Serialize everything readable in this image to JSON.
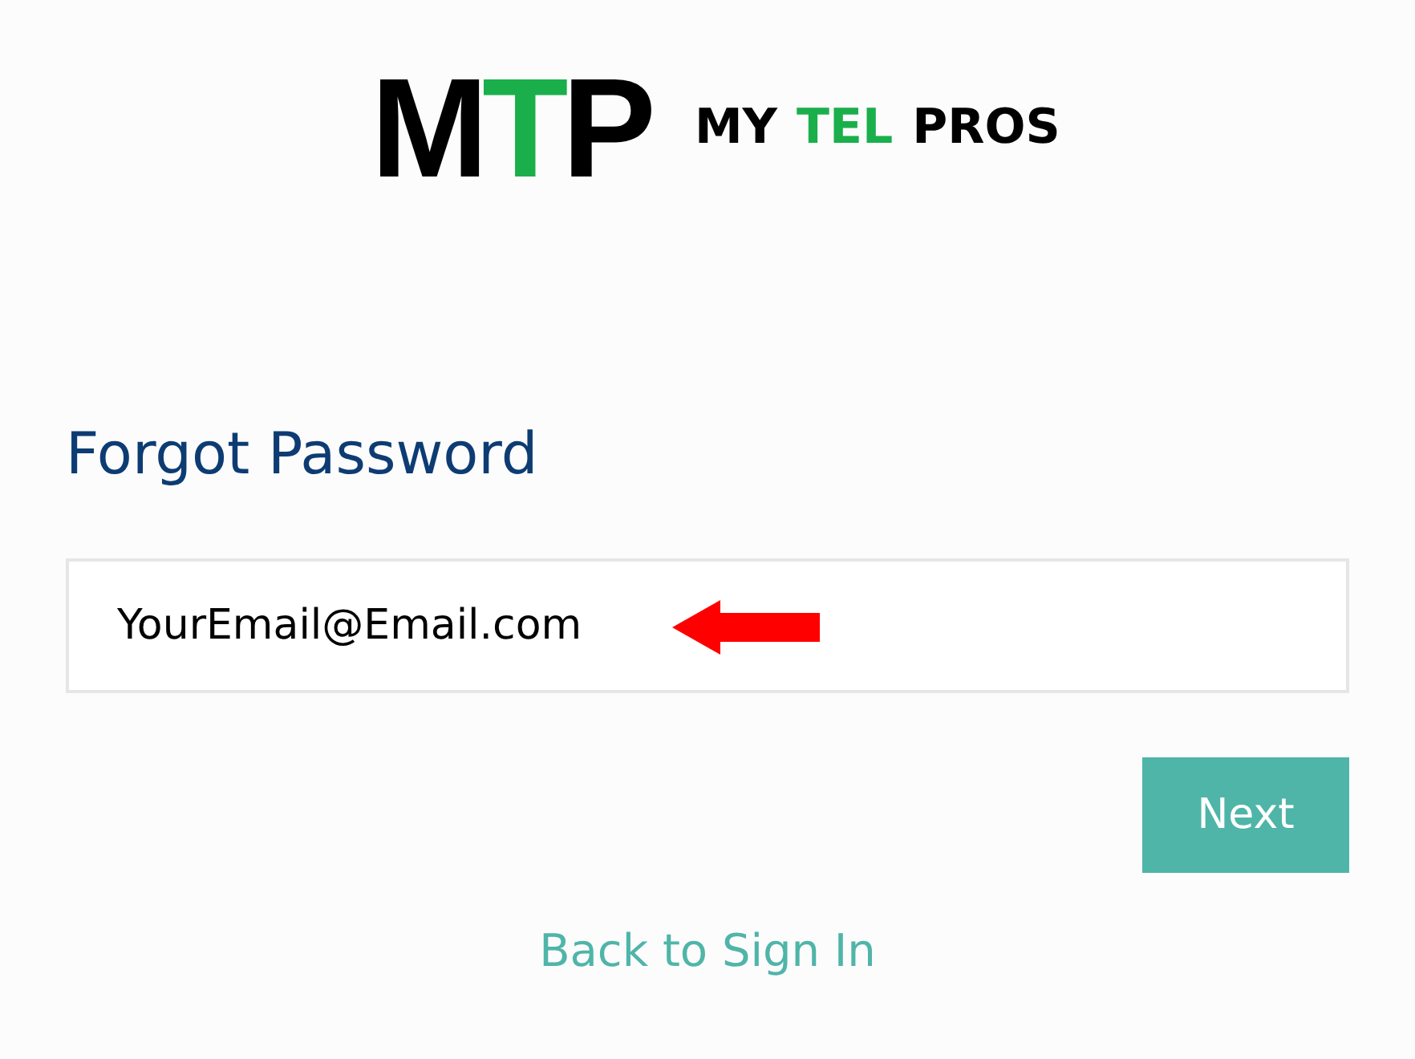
{
  "logo": {
    "mark": [
      {
        "text": "M",
        "color": "#000000"
      },
      {
        "text": "T",
        "color": "#1aaf4b"
      },
      {
        "text": "P",
        "color": "#000000"
      }
    ],
    "words": [
      {
        "text": "MY",
        "color": "#000000"
      },
      {
        "text": "TEL",
        "color": "#1aaf4b"
      },
      {
        "text": "PROS",
        "color": "#000000"
      }
    ]
  },
  "heading": "Forgot Password",
  "email_field": {
    "value": "YourEmail@Email.com"
  },
  "next_button": "Next",
  "back_link": "Back to Sign In"
}
